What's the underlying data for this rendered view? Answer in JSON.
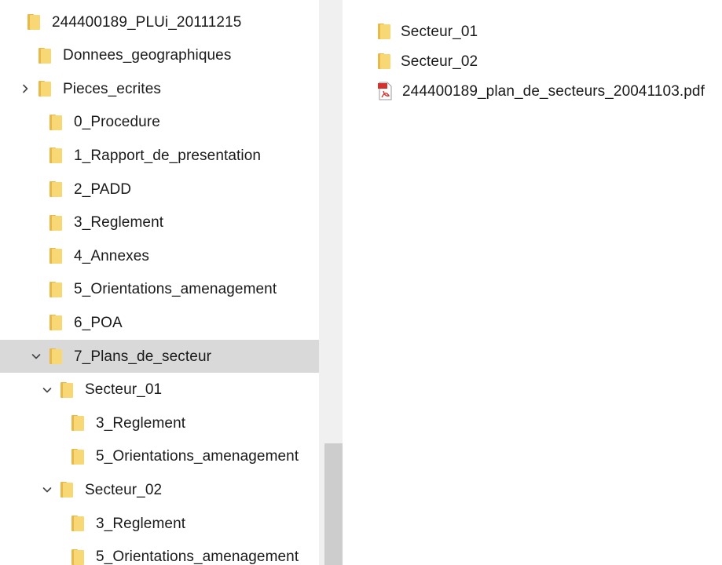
{
  "tree": {
    "items": [
      {
        "label": "244400189_PLUi_20111215",
        "level": 0,
        "expander": "none",
        "selected": false
      },
      {
        "label": "Donnees_geographiques",
        "level": 1,
        "expander": "none",
        "selected": false
      },
      {
        "label": "Pieces_ecrites",
        "level": 1,
        "expander": "collapsed",
        "selected": false
      },
      {
        "label": "0_Procedure",
        "level": 2,
        "expander": "none",
        "selected": false
      },
      {
        "label": "1_Rapport_de_presentation",
        "level": 2,
        "expander": "none",
        "selected": false
      },
      {
        "label": "2_PADD",
        "level": 2,
        "expander": "none",
        "selected": false
      },
      {
        "label": "3_Reglement",
        "level": 2,
        "expander": "none",
        "selected": false
      },
      {
        "label": "4_Annexes",
        "level": 2,
        "expander": "none",
        "selected": false
      },
      {
        "label": "5_Orientations_amenagement",
        "level": 2,
        "expander": "none",
        "selected": false
      },
      {
        "label": "6_POA",
        "level": 2,
        "expander": "none",
        "selected": false
      },
      {
        "label": "7_Plans_de_secteur",
        "level": 2,
        "expander": "expanded",
        "selected": true
      },
      {
        "label": "Secteur_01",
        "level": 3,
        "expander": "expanded",
        "selected": false
      },
      {
        "label": "3_Reglement",
        "level": 4,
        "expander": "none",
        "selected": false
      },
      {
        "label": "5_Orientations_amenagement",
        "level": 4,
        "expander": "none",
        "selected": false
      },
      {
        "label": "Secteur_02",
        "level": 3,
        "expander": "expanded",
        "selected": false
      },
      {
        "label": "3_Reglement",
        "level": 4,
        "expander": "none",
        "selected": false
      },
      {
        "label": "5_Orientations_amenagement",
        "level": 4,
        "expander": "none",
        "selected": false
      }
    ]
  },
  "content": {
    "items": [
      {
        "label": "Secteur_01",
        "type": "folder"
      },
      {
        "label": "Secteur_02",
        "type": "folder"
      },
      {
        "label": "244400189_plan_de_secteurs_20041103.pdf",
        "type": "pdf"
      }
    ]
  },
  "icons": {
    "folder": "folder-icon",
    "pdf": "pdf-file-icon",
    "expanded": "chevron-down-icon",
    "collapsed": "chevron-right-icon"
  },
  "colors": {
    "folder_body": "#f8d775",
    "folder_back": "#e8b849",
    "selected_bg": "#d9d9d9",
    "scroll_track": "#f0f0f0",
    "scroll_thumb": "#cdcdcd",
    "pdf_red": "#d6312b"
  }
}
